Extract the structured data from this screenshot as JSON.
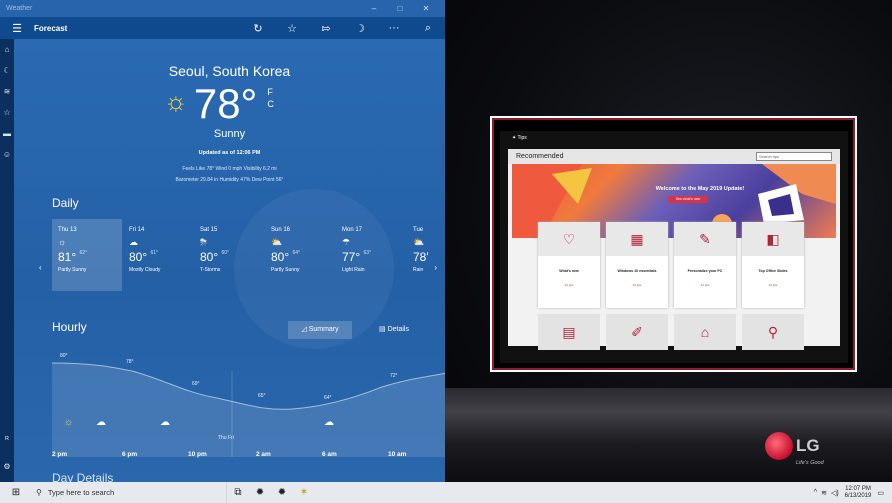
{
  "window": {
    "title": "Weather",
    "controls": {
      "minimize": "–",
      "maximize": "□",
      "close": "✕"
    }
  },
  "appbar": {
    "menu_icon": "hamburger-icon",
    "title": "Forecast",
    "buttons": [
      {
        "name": "refresh-button",
        "glyph": "↻"
      },
      {
        "name": "favorite-button",
        "glyph": "☆"
      },
      {
        "name": "pin-button",
        "glyph": "⇰"
      },
      {
        "name": "night-mode-button",
        "glyph": "☽"
      },
      {
        "name": "more-button",
        "glyph": "···"
      },
      {
        "name": "search-button",
        "glyph": "⌕"
      }
    ]
  },
  "rail": {
    "items": [
      {
        "name": "rail-home-icon",
        "glyph": "⌂"
      },
      {
        "name": "rail-forecast-icon",
        "glyph": "☾"
      },
      {
        "name": "rail-maps-icon",
        "glyph": "≋"
      },
      {
        "name": "rail-favorites-icon",
        "glyph": "☆"
      },
      {
        "name": "rail-news-icon",
        "glyph": "▬"
      },
      {
        "name": "rail-settings-icon",
        "glyph": "☺"
      }
    ],
    "bottom": [
      {
        "name": "rail-account-icon",
        "glyph": "ᴿ"
      },
      {
        "name": "rail-gear-icon",
        "glyph": "⚙"
      }
    ]
  },
  "current": {
    "city": "Seoul, South Korea",
    "icon": "sun-icon",
    "temp": "78°",
    "unit_f": "F",
    "unit_c": "C",
    "condition": "Sunny",
    "updated": "Updated as of 12:06 PM",
    "details_line1": "Feels Like  78°     Wind  0 mph     Visibility  6.2 mi",
    "details_line2": "Barometer  29.84 in     Humidity  47%     Dew Point  56°"
  },
  "daily": {
    "heading": "Daily",
    "days": [
      {
        "name": "Thu 13",
        "icon": "sun-icon",
        "glyph": "☼",
        "hi": "81°",
        "lo": "62°",
        "cond": "Partly Sunny"
      },
      {
        "name": "Fri 14",
        "icon": "cloud-icon",
        "glyph": "☁",
        "hi": "80°",
        "lo": "61°",
        "cond": "Mostly Cloudy"
      },
      {
        "name": "Sat 15",
        "icon": "storm-icon",
        "glyph": "⛈",
        "hi": "80°",
        "lo": "60°",
        "cond": "T-Storms"
      },
      {
        "name": "Sun 16",
        "icon": "partly-sunny-icon",
        "glyph": "⛅",
        "hi": "80°",
        "lo": "64°",
        "cond": "Partly Sunny"
      },
      {
        "name": "Mon 17",
        "icon": "rain-icon",
        "glyph": "☂",
        "hi": "77°",
        "lo": "63°",
        "cond": "Light Rain"
      },
      {
        "name": "Tue",
        "icon": "partly-sunny-icon",
        "glyph": "⛅",
        "hi": "78'",
        "lo": "",
        "cond": "Rain"
      }
    ]
  },
  "hourly": {
    "heading": "Hourly",
    "summary_label": "Summary",
    "details_label": "Details",
    "temps": [
      "80°",
      "78°",
      "69°",
      "65°",
      "64°",
      "72°"
    ],
    "day_marker": "Thu  Fri",
    "times": [
      "2 pm",
      "6 pm",
      "10 pm",
      "2 am",
      "6 am",
      "10 am"
    ]
  },
  "day_details": {
    "heading": "Day Details"
  },
  "tips": {
    "title": "Tips",
    "header": "Recommended",
    "search_placeholder": "Search tips",
    "hero_title": "Welcome to the May 2019 Update!",
    "hero_button": "See what's new",
    "tiles": [
      {
        "icon": "heart-icon",
        "glyph": "♡",
        "title": "What's new",
        "link": "14 tips"
      },
      {
        "icon": "windows-icon",
        "glyph": "▦",
        "title": "Windows 10 essentials",
        "link": "14 tips"
      },
      {
        "icon": "brush-icon",
        "glyph": "✎",
        "title": "Personalize your PC",
        "link": "14 tips"
      },
      {
        "icon": "office-icon",
        "glyph": "◧",
        "title": "Top Office Slides",
        "link": "14 tips"
      }
    ],
    "tiles_row2": [
      {
        "icon": "clipboard-icon",
        "glyph": "▤"
      },
      {
        "icon": "pen-icon",
        "glyph": "✐"
      },
      {
        "icon": "lock-icon",
        "glyph": "⌂"
      },
      {
        "icon": "search-icon",
        "glyph": "⚲"
      }
    ]
  },
  "brand": {
    "logo_text": "LG",
    "slogan": "Life's Good"
  },
  "taskbar": {
    "start_icon": "windows-start-icon",
    "search_placeholder": "Type here to search",
    "apps": [
      {
        "name": "task-view-icon",
        "glyph": "⧉"
      },
      {
        "name": "app-icon-1",
        "glyph": "✹"
      },
      {
        "name": "app-icon-2",
        "glyph": "✹"
      },
      {
        "name": "app-icon-3",
        "glyph": "✶"
      }
    ],
    "tray": {
      "chevron": "^",
      "wifi": "≋",
      "volume": "◁)",
      "time": "12:07 PM",
      "date": "6/13/2019"
    }
  },
  "colors": {
    "weather_bg": "#2462a9",
    "accent_red": "#b3243a",
    "taskbar": "#e6e9ee"
  }
}
